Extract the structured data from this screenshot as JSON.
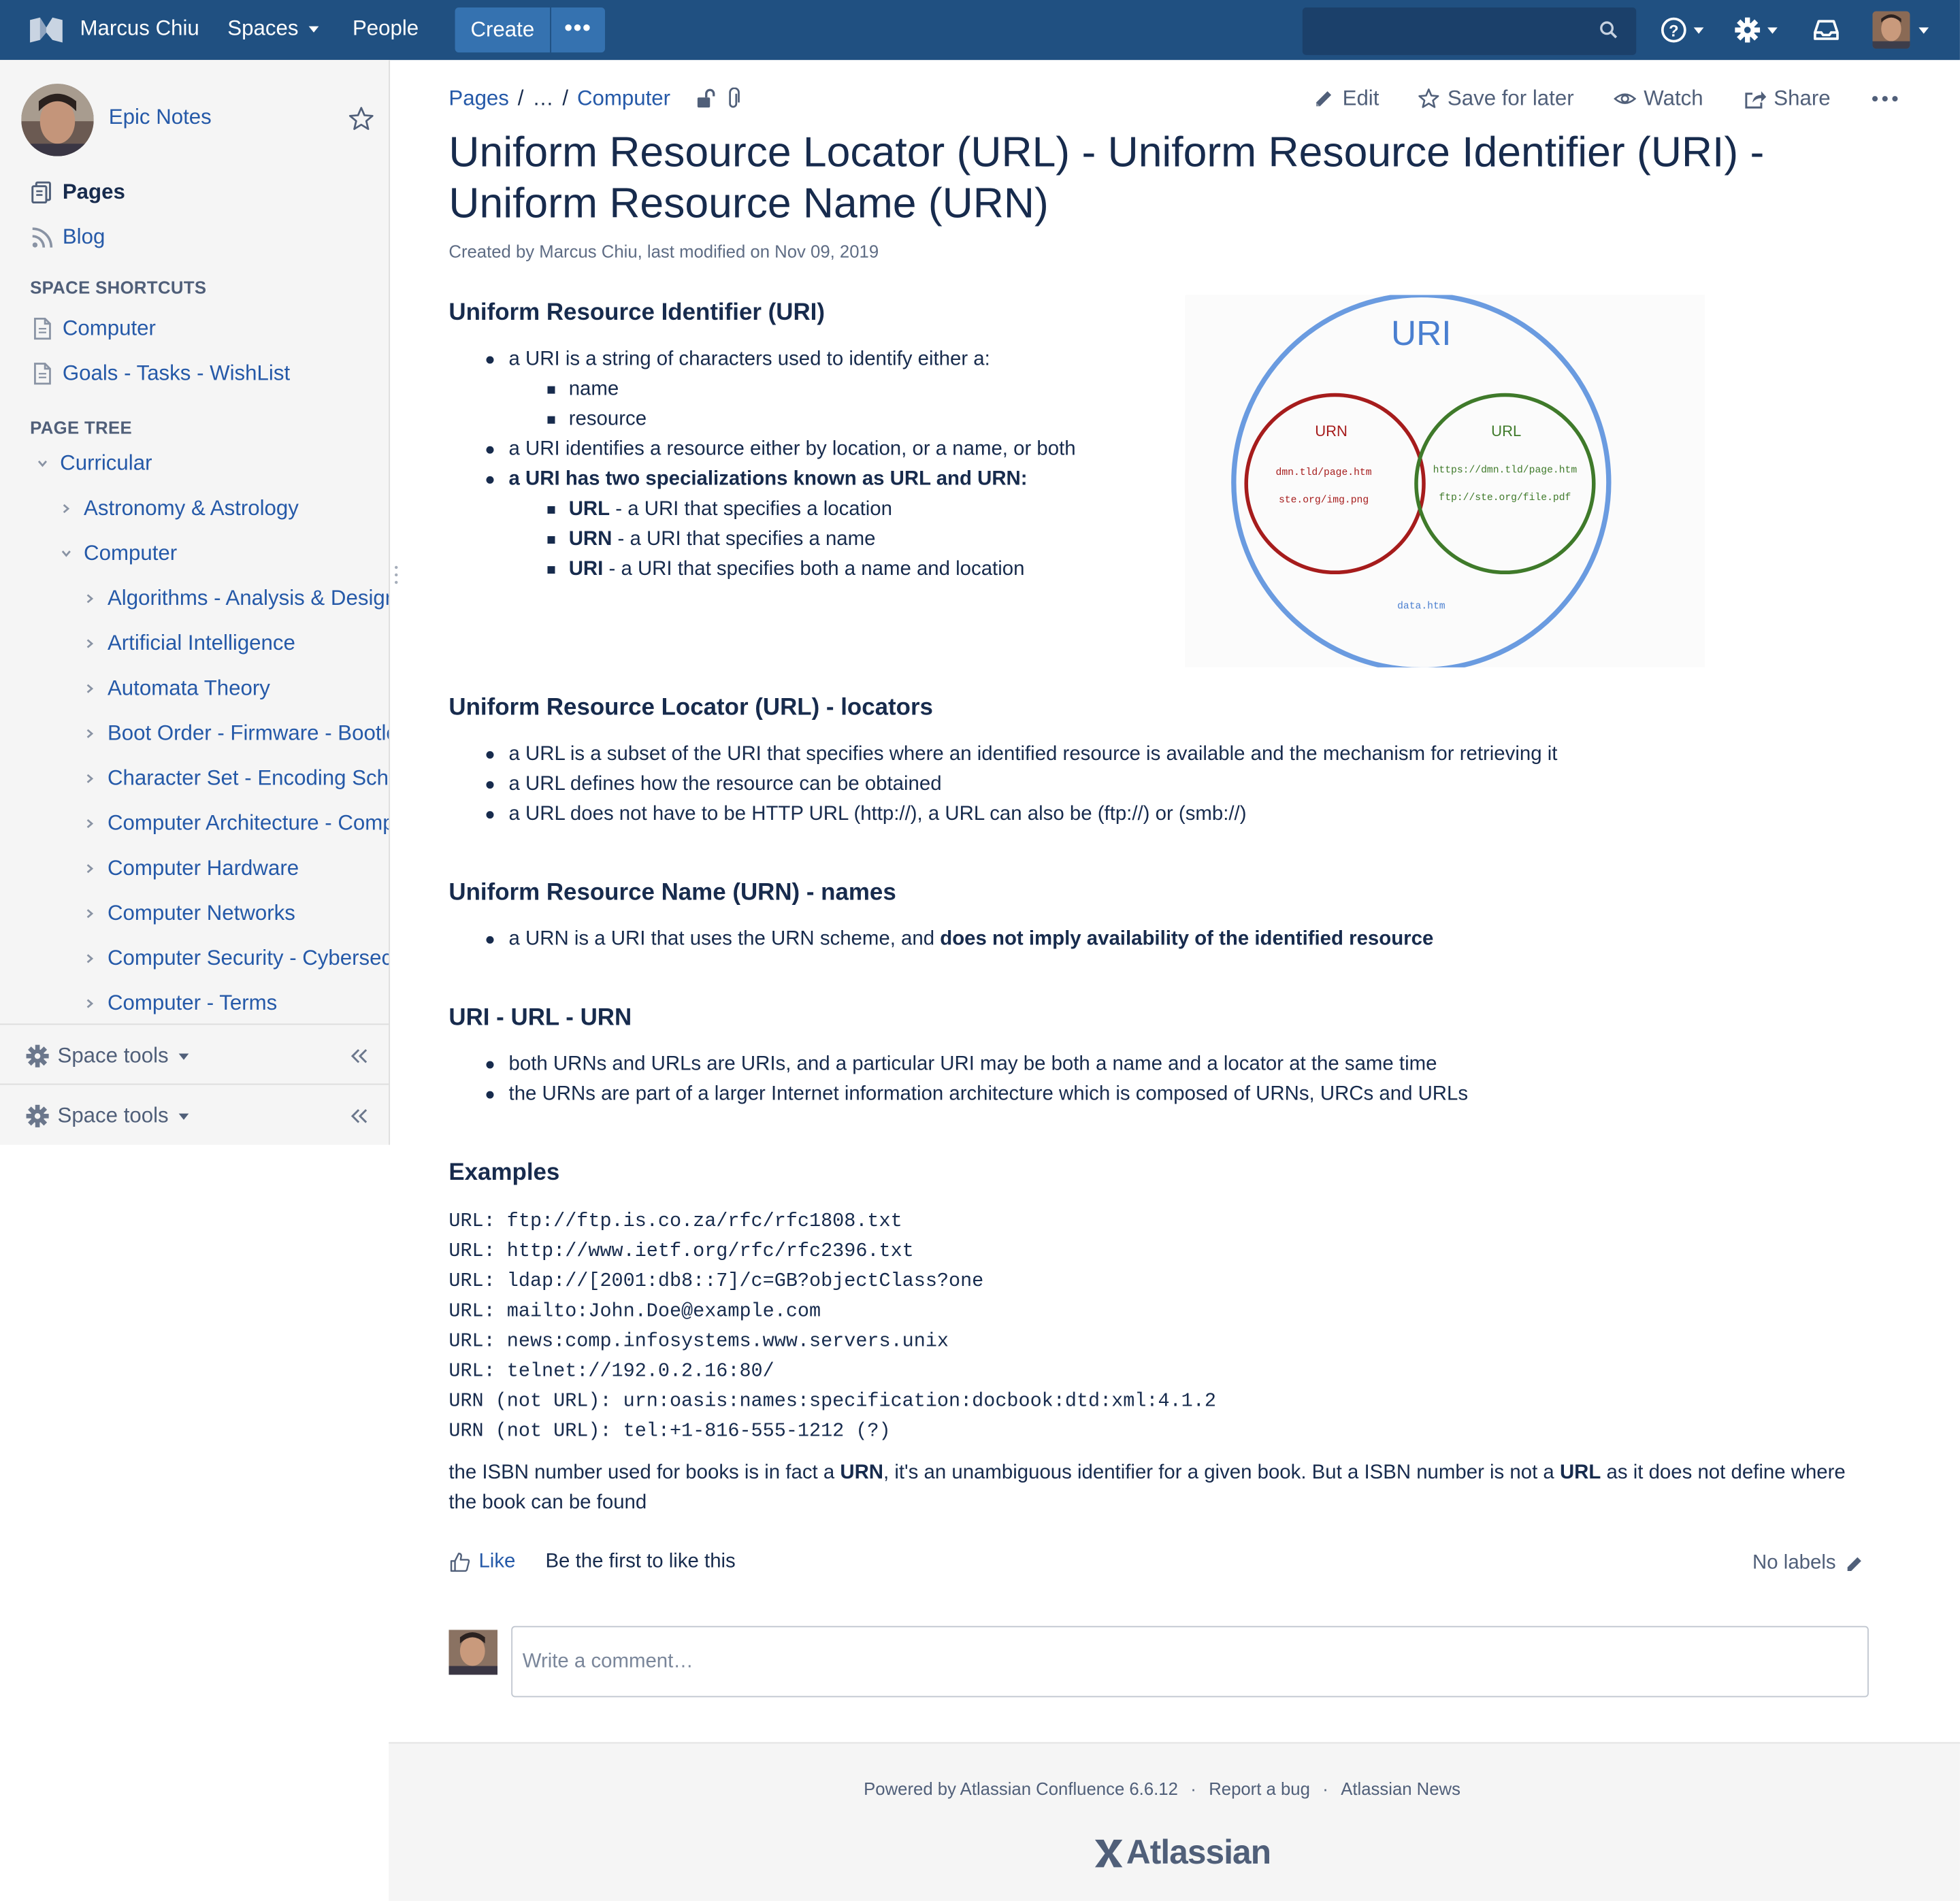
{
  "header": {
    "user": "Marcus Chiu",
    "spaces": "Spaces",
    "people": "People",
    "create": "Create",
    "more": "•••",
    "search_placeholder": ""
  },
  "sidebar": {
    "space_name": "Epic Notes",
    "nav": [
      {
        "label": "Pages",
        "icon": "pages-icon"
      },
      {
        "label": "Blog",
        "icon": "blog-icon"
      }
    ],
    "shortcuts_heading": "SPACE SHORTCUTS",
    "shortcuts": [
      "Computer",
      "Goals - Tasks - WishList"
    ],
    "tree_heading": "PAGE TREE",
    "tree": {
      "root": "Curricular",
      "level1": [
        "Astronomy & Astrology",
        "Computer"
      ],
      "computer_children": [
        "Algorithms - Analysis & Design",
        "Artificial Intelligence",
        "Automata Theory",
        "Boot Order - Firmware - Bootloader",
        "Character Set - Encoding Scheme",
        "Computer Architecture - Computer Organization",
        "Computer Hardware",
        "Computer Networks",
        "Computer Security - Cybersecurity",
        "Computer - Terms"
      ]
    },
    "space_tools": "Space tools"
  },
  "breadcrumbs": [
    "Pages",
    "…",
    "Computer"
  ],
  "actions": {
    "edit": "Edit",
    "save": "Save for later",
    "watch": "Watch",
    "share": "Share"
  },
  "page": {
    "title": "Uniform Resource Locator (URL) - Uniform Resource Identifier (URI) - Uniform Resource Name (URN)",
    "meta": "Created by Marcus Chiu, last modified on Nov 09, 2019",
    "uri": {
      "heading": "Uniform Resource Identifier (URI)",
      "b1": "a URI is a string of characters used to identify either a:",
      "b1_sub": [
        "name",
        "resource"
      ],
      "b2": "a URI identifies a resource either by location, or a name, or both",
      "b3": "a URI has two specializations known as URL and URN:",
      "b3_sub": [
        {
          "term": "URL",
          "text": " - a URI that specifies a location"
        },
        {
          "term": "URN",
          "text": " - a URI that specifies a name"
        },
        {
          "term": "URI",
          "text": " - a URI that specifies both a name and location"
        }
      ]
    },
    "diagram": {
      "outer": "URI",
      "urn": "URN",
      "url": "URL",
      "urn_items": [
        "dmn.tld/page.htm",
        "ste.org/img.png"
      ],
      "url_items": [
        "https://dmn.tld/page.htm",
        "ftp://ste.org/file.pdf"
      ],
      "uri_item": "data.htm",
      "colors": {
        "uri": "#6a9be0",
        "urn": "#a61c1c",
        "url": "#3f7a2a"
      }
    },
    "url": {
      "heading": "Uniform Resource Locator (URL) - locators",
      "bullets": [
        "a URL is a subset of the URI that specifies where an identified resource is available and the mechanism for retrieving it",
        "a URL defines how the resource can be obtained",
        "a URL does not have to be HTTP URL (http://), a URL can also be (ftp://) or (smb://)"
      ]
    },
    "urn": {
      "heading": "Uniform Resource Name (URN) - names",
      "b1_pre": "a URN is a URI that uses the URN scheme, and ",
      "b1_bold": "does not imply availability of the identified resource"
    },
    "combo": {
      "heading": "URI - URL - URN",
      "bullets": [
        "both URNs and URLs are URIs, and a particular URI may be both a name and a locator at the same time",
        "the URNs are part of a larger Internet information architecture which is composed of URNs, URCs and URLs"
      ]
    },
    "examples": {
      "heading": "Examples",
      "lines": [
        "URL: ftp://ftp.is.co.za/rfc/rfc1808.txt",
        "URL: http://www.ietf.org/rfc/rfc2396.txt",
        "URL: ldap://[2001:db8::7]/c=GB?objectClass?one",
        "URL: mailto:John.Doe@example.com",
        "URL: news:comp.infosystems.www.servers.unix",
        "URL: telnet://192.0.2.16:80/",
        "URN (not URL): urn:oasis:names:specification:docbook:dtd:xml:4.1.2",
        "URN (not URL): tel:+1-816-555-1212 (?)"
      ],
      "isbn": {
        "p1": "the ISBN number used for books is in fact a ",
        "b1": "URN",
        "p2": ", it's an unambiguous identifier for a given book. But a ISBN number is not a ",
        "b2": "URL",
        "p3": " as it does not define where the book can be found"
      }
    }
  },
  "social": {
    "like": "Like",
    "like_text": "Be the first to like this",
    "labels": "No labels"
  },
  "comment": {
    "placeholder": "Write a comment…"
  },
  "footer": {
    "powered": "Powered by Atlassian Confluence 6.6.12",
    "bug": "Report a bug",
    "news": "Atlassian News",
    "logo": "Atlassian"
  }
}
